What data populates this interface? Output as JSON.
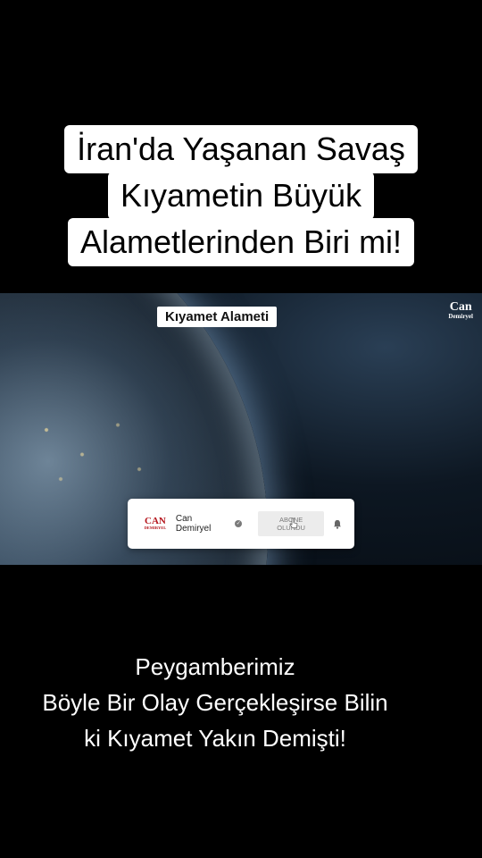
{
  "title": {
    "lines": [
      "İran'da Yaşanan Savaş",
      "Kıyametin Büyük",
      "Alametlerinden Biri mi!"
    ]
  },
  "video": {
    "label": "Kıyamet Alameti",
    "logo": {
      "top": "Can",
      "bottom": "Demiryel"
    },
    "subscribe_card": {
      "channel_logo_top": "CAN",
      "channel_logo_bottom": "DEMIRYEL",
      "channel_name": "Can Demiryel",
      "verified_icon": "check-circle-icon",
      "button_label": "ABONE OLUNDU",
      "bell_icon": "bell-icon",
      "cursor_icon": "cursor-hand-icon"
    }
  },
  "caption": {
    "lines": [
      "Peygamberimiz",
      "Böyle Bir Olay Gerçekleşirse Bilin",
      "ki Kıyamet Yakın Demişti!"
    ]
  },
  "colors": {
    "background": "#000000",
    "title_bg": "#ffffff",
    "brand_red": "#b4141b"
  }
}
